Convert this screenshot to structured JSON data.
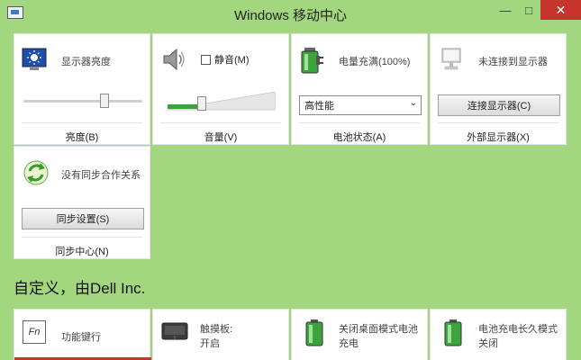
{
  "window": {
    "title": "Windows 移动中心",
    "controls": {
      "minimize": "—",
      "maximize": "□",
      "close": "✕"
    }
  },
  "tiles": {
    "brightness": {
      "status": "显示器亮度",
      "label": "亮度(B)",
      "level": 0.7,
      "icon": "display-brightness-icon"
    },
    "volume": {
      "mute_label": "静音(M)",
      "muted": false,
      "label": "音量(V)",
      "level": 0.3,
      "icon": "speaker-icon"
    },
    "battery": {
      "status": "电量充满(100%)",
      "selected": "高性能",
      "label": "电池状态(A)",
      "icon": "battery-plug-icon"
    },
    "display": {
      "status": "未连接到显示器",
      "button": "连接显示器(C)",
      "label": "外部显示器(X)",
      "icon": "monitor-icon"
    },
    "sync": {
      "status": "没有同步合作关系",
      "button": "同步设置(S)",
      "label": "同步中心(N)",
      "icon": "sync-arrows-icon"
    }
  },
  "custom": {
    "heading": "自定义，由Dell Inc.",
    "items": [
      {
        "title": "功能键行",
        "sub": "",
        "icon": "fn-key-icon"
      },
      {
        "title": "触摸板:",
        "sub": "开启",
        "icon": "touchpad-icon"
      },
      {
        "title": "关闭桌面模式电池",
        "sub": "充电",
        "icon": "battery-icon"
      },
      {
        "title": "电池充电长久模式",
        "sub": "关闭",
        "icon": "battery-icon"
      }
    ]
  },
  "colors": {
    "background": "#a3d77f",
    "close_button": "#c7342c",
    "volume_fill": "#3ea33e",
    "accent_bar": "#c0392b"
  }
}
